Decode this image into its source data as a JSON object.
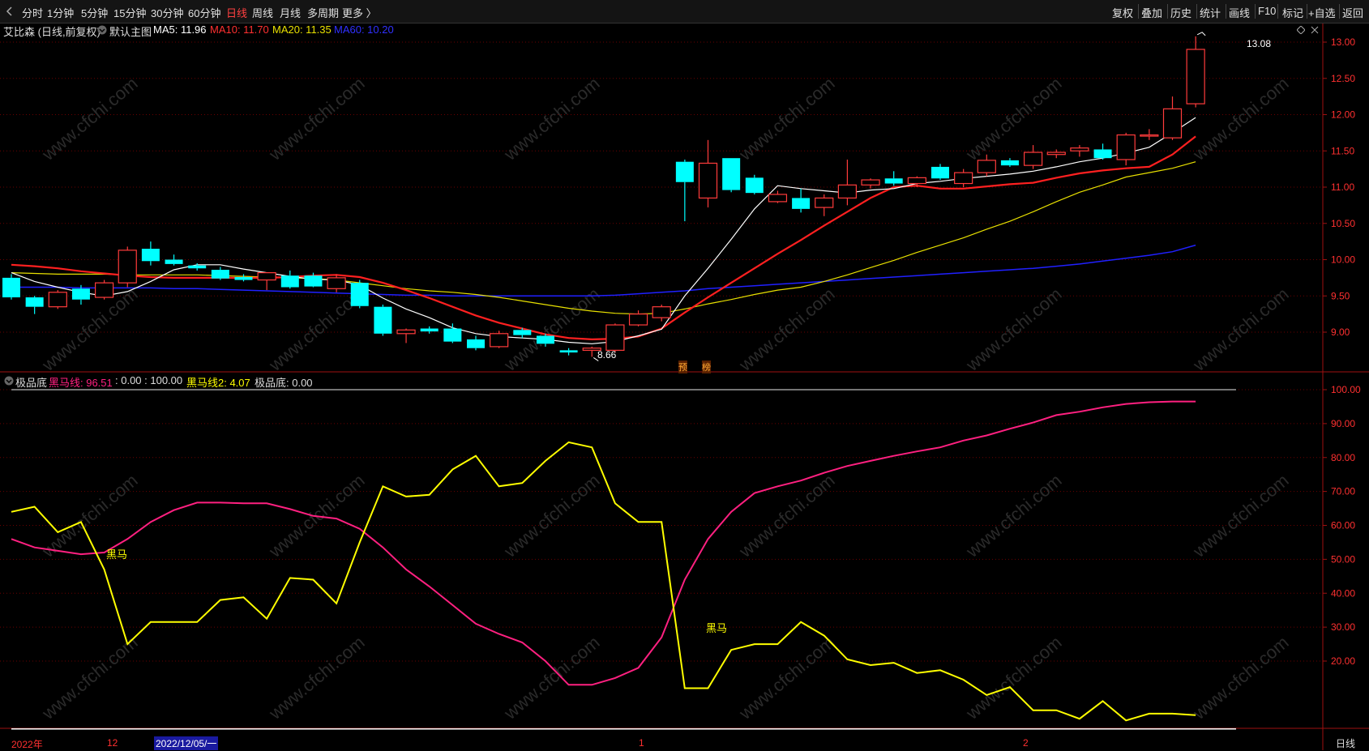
{
  "toolbar": {
    "tabs": [
      "分时",
      "1分钟",
      "5分钟",
      "15分钟",
      "30分钟",
      "60分钟",
      "日线",
      "周线",
      "月线",
      "多周期",
      "更多 〉"
    ],
    "active_tab": "日线",
    "right_buttons": [
      "复权",
      "叠加",
      "历史",
      "统计",
      "画线",
      "F10",
      "标记",
      "+自选",
      "返回"
    ]
  },
  "main_legend": {
    "stock": "艾比森 (日线,前复权)",
    "template": "默认主图",
    "ma5": "MA5: 11.96",
    "ma10": "MA10: 11.70",
    "ma20": "MA20: 11.35",
    "ma60": "MA60: 10.20"
  },
  "main_labels": {
    "high": "13.08",
    "low": "8.66",
    "tag1": "预",
    "tag2": "榜"
  },
  "indicator_legend": {
    "name": "极品底",
    "heima": "黑马线: 96.51",
    "range": ": 0.00 : 100.00",
    "heima2": "黑马线2: 4.07",
    "jipindi": "极品底: 0.00"
  },
  "indicator_labels": {
    "signal1": "黑马",
    "signal2": "黑马"
  },
  "xaxis": {
    "labels": [
      "2022年",
      "12",
      "2022/12/05/一",
      "1",
      "2"
    ]
  },
  "bottom_right": "日线",
  "watermark": "www.cfchi.com",
  "colors": {
    "up": "#ff3b3b",
    "down": "#00ffff",
    "ma5": "#ffffff",
    "ma10": "#ff2020",
    "ma20": "#e8e000",
    "ma60": "#2020ff",
    "heima": "#ff2080",
    "heima2": "#ffff00"
  },
  "chart_data": [
    {
      "type": "candlestick",
      "title": "艾比森 (日线,前复权)",
      "y_ticks": [
        9.0,
        9.5,
        10.0,
        10.5,
        11.0,
        11.5,
        12.0,
        12.5,
        13.0
      ],
      "ylim": [
        8.5,
        13.25
      ],
      "candles": [
        {
          "o": 9.75,
          "h": 9.8,
          "l": 9.45,
          "c": 9.48
        },
        {
          "o": 9.48,
          "h": 9.5,
          "l": 9.25,
          "c": 9.35
        },
        {
          "o": 9.35,
          "h": 9.58,
          "l": 9.32,
          "c": 9.55
        },
        {
          "o": 9.6,
          "h": 9.65,
          "l": 9.38,
          "c": 9.45
        },
        {
          "o": 9.48,
          "h": 9.72,
          "l": 9.45,
          "c": 9.68
        },
        {
          "o": 9.68,
          "h": 10.18,
          "l": 9.62,
          "c": 10.13
        },
        {
          "o": 10.15,
          "h": 10.25,
          "l": 9.92,
          "c": 9.98
        },
        {
          "o": 10.0,
          "h": 10.07,
          "l": 9.92,
          "c": 9.94
        },
        {
          "o": 9.92,
          "h": 9.95,
          "l": 9.85,
          "c": 9.88
        },
        {
          "o": 9.86,
          "h": 9.9,
          "l": 9.72,
          "c": 9.74
        },
        {
          "o": 9.76,
          "h": 9.8,
          "l": 9.7,
          "c": 9.72
        },
        {
          "o": 9.72,
          "h": 9.82,
          "l": 9.58,
          "c": 9.82
        },
        {
          "o": 9.78,
          "h": 9.85,
          "l": 9.6,
          "c": 9.62
        },
        {
          "o": 9.78,
          "h": 9.82,
          "l": 9.62,
          "c": 9.63
        },
        {
          "o": 9.6,
          "h": 9.8,
          "l": 9.55,
          "c": 9.75
        },
        {
          "o": 9.68,
          "h": 9.72,
          "l": 9.33,
          "c": 9.36
        },
        {
          "o": 9.35,
          "h": 9.38,
          "l": 8.95,
          "c": 8.98
        },
        {
          "o": 8.98,
          "h": 9.05,
          "l": 8.85,
          "c": 9.03
        },
        {
          "o": 9.05,
          "h": 9.08,
          "l": 8.98,
          "c": 9.01
        },
        {
          "o": 9.05,
          "h": 9.12,
          "l": 8.85,
          "c": 8.87
        },
        {
          "o": 8.9,
          "h": 8.95,
          "l": 8.75,
          "c": 8.78
        },
        {
          "o": 8.8,
          "h": 9.02,
          "l": 8.78,
          "c": 8.98
        },
        {
          "o": 9.03,
          "h": 9.06,
          "l": 8.92,
          "c": 8.96
        },
        {
          "o": 8.95,
          "h": 8.98,
          "l": 8.8,
          "c": 8.84
        },
        {
          "o": 8.75,
          "h": 8.78,
          "l": 8.68,
          "c": 8.72
        },
        {
          "o": 8.75,
          "h": 8.8,
          "l": 8.66,
          "c": 8.78
        },
        {
          "o": 8.75,
          "h": 9.12,
          "l": 8.72,
          "c": 9.1
        },
        {
          "o": 9.1,
          "h": 9.3,
          "l": 9.08,
          "c": 9.25
        },
        {
          "o": 9.2,
          "h": 9.38,
          "l": 9.15,
          "c": 9.35
        },
        {
          "o": 11.35,
          "h": 11.38,
          "l": 10.53,
          "c": 11.07
        },
        {
          "o": 10.85,
          "h": 11.65,
          "l": 10.72,
          "c": 11.33
        },
        {
          "o": 11.4,
          "h": 11.4,
          "l": 10.93,
          "c": 10.96
        },
        {
          "o": 11.13,
          "h": 11.17,
          "l": 10.9,
          "c": 10.92
        },
        {
          "o": 10.8,
          "h": 10.95,
          "l": 10.78,
          "c": 10.9
        },
        {
          "o": 10.85,
          "h": 10.98,
          "l": 10.65,
          "c": 10.7
        },
        {
          "o": 10.72,
          "h": 10.9,
          "l": 10.6,
          "c": 10.85
        },
        {
          "o": 10.85,
          "h": 11.38,
          "l": 10.75,
          "c": 11.03
        },
        {
          "o": 11.03,
          "h": 11.12,
          "l": 10.98,
          "c": 11.1
        },
        {
          "o": 11.12,
          "h": 11.22,
          "l": 11.02,
          "c": 11.05
        },
        {
          "o": 11.05,
          "h": 11.15,
          "l": 11.0,
          "c": 11.13
        },
        {
          "o": 11.28,
          "h": 11.32,
          "l": 11.1,
          "c": 11.12
        },
        {
          "o": 11.05,
          "h": 11.25,
          "l": 11.0,
          "c": 11.2
        },
        {
          "o": 11.2,
          "h": 11.45,
          "l": 11.15,
          "c": 11.37
        },
        {
          "o": 11.37,
          "h": 11.4,
          "l": 11.28,
          "c": 11.3
        },
        {
          "o": 11.3,
          "h": 11.58,
          "l": 11.25,
          "c": 11.48
        },
        {
          "o": 11.45,
          "h": 11.52,
          "l": 11.4,
          "c": 11.48
        },
        {
          "o": 11.5,
          "h": 11.58,
          "l": 11.42,
          "c": 11.54
        },
        {
          "o": 11.52,
          "h": 11.6,
          "l": 11.38,
          "c": 11.4
        },
        {
          "o": 11.38,
          "h": 11.75,
          "l": 11.3,
          "c": 11.72
        },
        {
          "o": 11.72,
          "h": 11.8,
          "l": 11.65,
          "c": 11.72
        },
        {
          "o": 11.68,
          "h": 12.25,
          "l": 11.65,
          "c": 12.08
        },
        {
          "o": 12.15,
          "h": 13.08,
          "l": 12.1,
          "c": 12.9
        }
      ],
      "ma5": [
        9.82,
        9.7,
        9.62,
        9.55,
        9.5,
        9.56,
        9.7,
        9.86,
        9.93,
        9.93,
        9.87,
        9.82,
        9.77,
        9.73,
        9.72,
        9.65,
        9.47,
        9.32,
        9.2,
        9.06,
        8.98,
        8.94,
        8.92,
        8.9,
        8.86,
        8.84,
        8.87,
        8.95,
        9.04,
        9.5,
        9.88,
        10.28,
        10.7,
        11.02,
        10.98,
        10.95,
        10.92,
        10.96,
        10.98,
        11.05,
        11.08,
        11.12,
        11.15,
        11.18,
        11.22,
        11.28,
        11.35,
        11.4,
        11.47,
        11.55,
        11.75,
        11.96
      ],
      "ma10": [
        9.93,
        9.91,
        9.88,
        9.84,
        9.81,
        9.78,
        9.76,
        9.75,
        9.75,
        9.75,
        9.75,
        9.75,
        9.76,
        9.78,
        9.79,
        9.76,
        9.68,
        9.58,
        9.47,
        9.35,
        9.23,
        9.13,
        9.05,
        8.97,
        8.92,
        8.9,
        8.91,
        8.94,
        9.05,
        9.27,
        9.48,
        9.68,
        9.88,
        10.08,
        10.27,
        10.47,
        10.66,
        10.85,
        11.0,
        11.02,
        10.98,
        10.98,
        11.01,
        11.04,
        11.06,
        11.13,
        11.19,
        11.23,
        11.26,
        11.28,
        11.45,
        11.7
      ],
      "ma20": [
        9.82,
        9.81,
        9.8,
        9.8,
        9.8,
        9.79,
        9.79,
        9.79,
        9.79,
        9.78,
        9.77,
        9.76,
        9.75,
        9.74,
        9.72,
        9.68,
        9.64,
        9.6,
        9.57,
        9.55,
        9.52,
        9.48,
        9.43,
        9.38,
        9.33,
        9.29,
        9.26,
        9.25,
        9.26,
        9.32,
        9.39,
        9.45,
        9.52,
        9.58,
        9.62,
        9.7,
        9.79,
        9.89,
        9.99,
        10.1,
        10.2,
        10.3,
        10.42,
        10.53,
        10.66,
        10.8,
        10.93,
        11.03,
        11.14,
        11.2,
        11.26,
        11.35
      ],
      "ma60": [
        9.62,
        9.62,
        9.62,
        9.61,
        9.61,
        9.61,
        9.61,
        9.6,
        9.6,
        9.59,
        9.58,
        9.57,
        9.56,
        9.55,
        9.54,
        9.53,
        9.52,
        9.51,
        9.51,
        9.5,
        9.5,
        9.5,
        9.5,
        9.5,
        9.5,
        9.5,
        9.51,
        9.53,
        9.55,
        9.57,
        9.6,
        9.62,
        9.64,
        9.66,
        9.68,
        9.7,
        9.72,
        9.74,
        9.76,
        9.78,
        9.8,
        9.82,
        9.84,
        9.86,
        9.88,
        9.91,
        9.94,
        9.98,
        10.02,
        10.06,
        10.11,
        10.2
      ]
    },
    {
      "type": "line",
      "title": "极品底",
      "y_ticks": [
        20.0,
        30.0,
        40.0,
        50.0,
        60.0,
        70.0,
        80.0,
        90.0,
        100.0
      ],
      "ylim": [
        0,
        102
      ],
      "series": [
        {
          "name": "黑马线",
          "values": [
            56,
            53.5,
            52.5,
            51.5,
            52,
            56,
            61,
            64.5,
            66.7,
            66.7,
            66.5,
            66.5,
            64.8,
            62.8,
            62,
            59,
            53.5,
            47,
            42,
            36.5,
            31,
            28,
            25.5,
            20,
            13,
            13,
            15,
            18,
            27,
            44,
            56,
            64,
            69.5,
            71.5,
            73.2,
            75.5,
            77.5,
            79,
            80.5,
            81.8,
            83,
            85,
            86.5,
            88.5,
            90.3,
            92.5,
            93.5,
            94.8,
            95.8,
            96.3,
            96.51,
            96.51
          ]
        },
        {
          "name": "黑马线2",
          "values": [
            64,
            65.5,
            58,
            61,
            47,
            25,
            31.5,
            31.5,
            31.5,
            38,
            38.8,
            32.5,
            44.5,
            44,
            37,
            55,
            71.5,
            68.5,
            69,
            76.5,
            80.5,
            71.5,
            72.5,
            79,
            84.5,
            83,
            66.5,
            61,
            61,
            12,
            12,
            23.3,
            25,
            25,
            31.5,
            27.5,
            20.5,
            18.8,
            19.5,
            16.5,
            17.3,
            14.5,
            10,
            12.3,
            5.5,
            5.5,
            3,
            8.2,
            2.5,
            4.5,
            4.5,
            4.07
          ]
        }
      ]
    }
  ]
}
